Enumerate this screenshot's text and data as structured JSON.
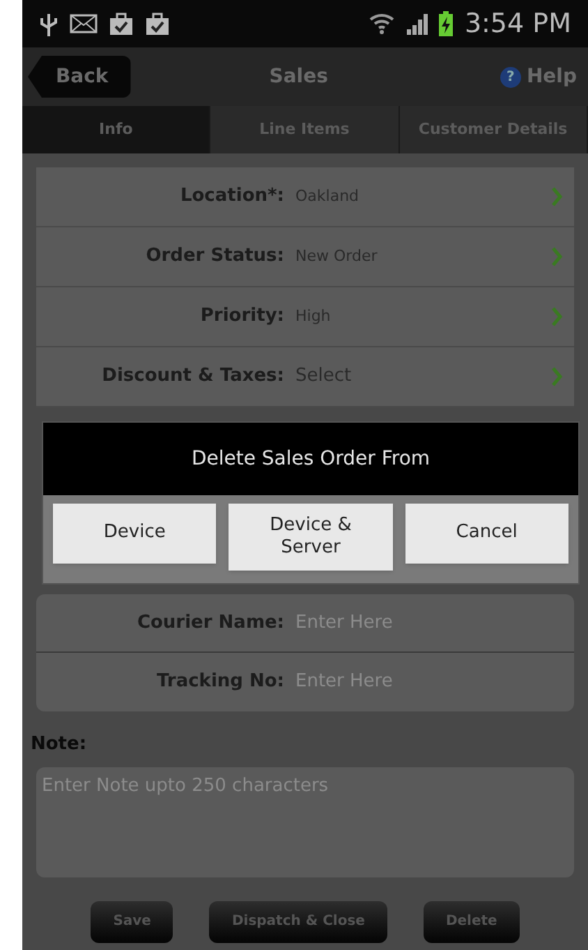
{
  "status_bar": {
    "time": "3:54 PM"
  },
  "header": {
    "back": "Back",
    "title": "Sales",
    "help_icon": "?",
    "help": "Help"
  },
  "tabs": [
    {
      "label": "Info",
      "selected": true
    },
    {
      "label": "Line Items",
      "selected": false
    },
    {
      "label": "Customer Details",
      "selected": false
    }
  ],
  "fields": [
    {
      "label": "Location*:",
      "value": "Oakland"
    },
    {
      "label": "Order Status:",
      "value": "New Order"
    },
    {
      "label": "Priority:",
      "value": "High"
    },
    {
      "label": "Discount & Taxes:",
      "value": "Select"
    }
  ],
  "shipping": [
    {
      "label": "Courier Name:",
      "placeholder": "Enter Here"
    },
    {
      "label": "Tracking No:",
      "placeholder": "Enter Here"
    }
  ],
  "note": {
    "label": "Note:",
    "placeholder": "Enter Note upto 250 characters"
  },
  "actions": [
    "Save",
    "Dispatch & Close",
    "Delete"
  ],
  "dialog": {
    "title": "Delete Sales Order From",
    "buttons": [
      "Device",
      "Device &\nServer",
      "Cancel"
    ]
  }
}
